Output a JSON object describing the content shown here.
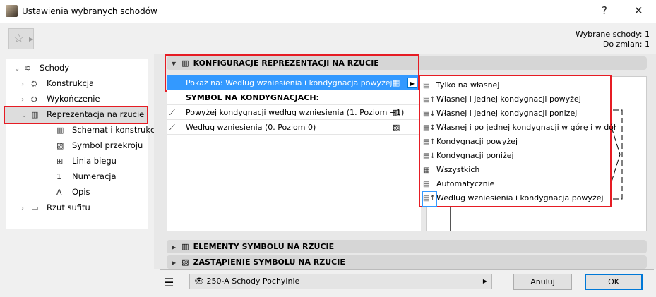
{
  "window": {
    "title": "Ustawienia wybranych schodów",
    "help": "?",
    "close": "✕"
  },
  "info": {
    "selected": "Wybrane schody: 1",
    "to_change": "Do zmian: 1"
  },
  "tree": [
    {
      "label": "Schody",
      "chev": "⌄",
      "icon": "≋"
    },
    {
      "label": "Konstrukcja",
      "chev": "›",
      "icon": "⛭"
    },
    {
      "label": "Wykończenie",
      "chev": "›",
      "icon": "⛭"
    },
    {
      "label": "Reprezentacja na rzucie",
      "chev": "⌄",
      "icon": "▥"
    },
    {
      "label": "Schemat i konstrukcja",
      "icon": "▥"
    },
    {
      "label": "Symbol przekroju",
      "icon": "▧"
    },
    {
      "label": "Linia biegu",
      "icon": "⊞"
    },
    {
      "label": "Numeracja",
      "icon": "1"
    },
    {
      "label": "Opis",
      "icon": "A"
    },
    {
      "label": "Rzut sufitu",
      "chev": "›",
      "icon": "▭"
    }
  ],
  "sections": {
    "config": "KONFIGURACJE REPREZENTACJI NA RZUCIE",
    "elements": "ELEMENTY SYMBOLU NA RZUCIE",
    "override": "ZASTĄPIENIE SYMBOLU NA RZUCIE"
  },
  "show_on": "Pokaż na: Według wzniesienia i kondygnacja powyżej",
  "symbol_header": "SYMBOL NA KONDYGNACJACH:",
  "rows": [
    "Powyżej kondygnacji według wzniesienia (1. Poziom +1)",
    "Według wzniesienia (0. Poziom 0)"
  ],
  "popup": [
    "Tylko na własnej",
    "Własnej i jednej kondygnacji powyżej",
    "Własnej i jednej kondygnacji poniżej",
    "Własnej i po jednej kondygnacji w górę i w dół",
    "Kondygnacji powyżej",
    "Kondygnacji poniżej",
    "Wszystkich",
    "Automatycznie",
    "Według wzniesienia i kondygnacja powyżej"
  ],
  "layer": "250-A Schody Pochylnie",
  "buttons": {
    "cancel": "Anuluj",
    "ok": "OK"
  }
}
